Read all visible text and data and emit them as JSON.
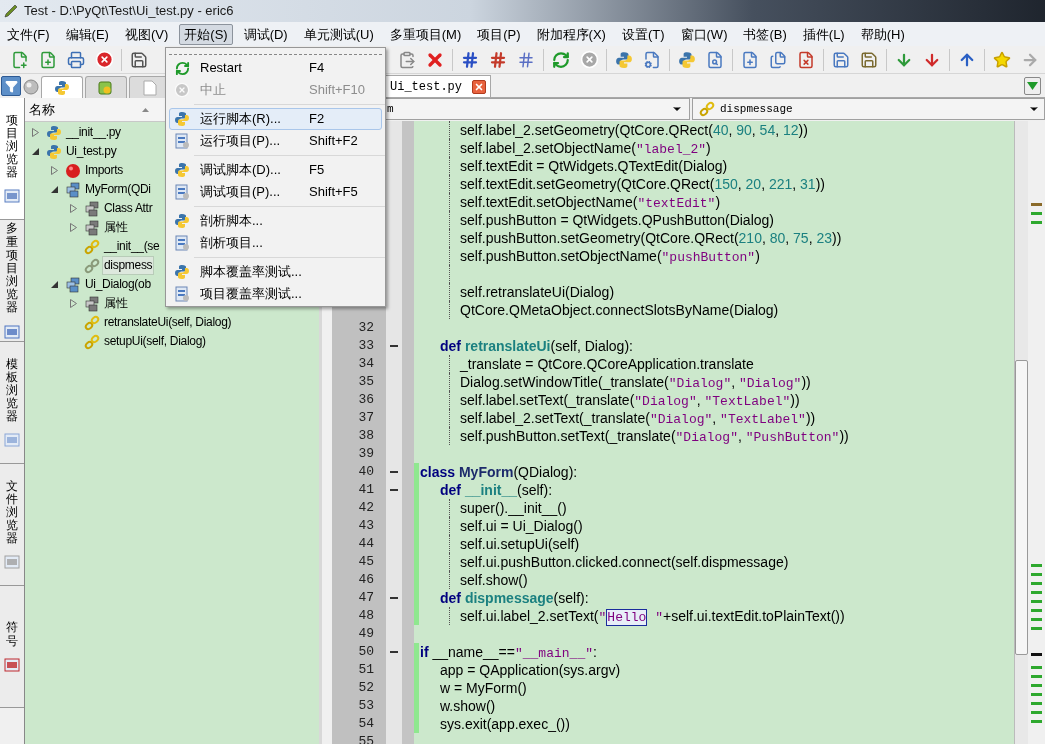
{
  "window": {
    "title": "Test - D:\\PyQt\\Test\\Ui_test.py - eric6"
  },
  "menu_bar": [
    {
      "label": "文件(F)",
      "selected": false
    },
    {
      "label": "编辑(E)",
      "selected": false
    },
    {
      "label": "视图(V)",
      "selected": false
    },
    {
      "label": "开始(S)",
      "selected": true
    },
    {
      "label": "调试(D)",
      "selected": false
    },
    {
      "label": "单元测试(U)",
      "selected": false
    },
    {
      "label": "多重项目(M)",
      "selected": false
    },
    {
      "label": "项目(P)",
      "selected": false
    },
    {
      "label": "附加程序(X)",
      "selected": false
    },
    {
      "label": "设置(T)",
      "selected": false
    },
    {
      "label": "窗口(W)",
      "selected": false
    },
    {
      "label": "书签(B)",
      "selected": false
    },
    {
      "label": "插件(L)",
      "selected": false
    },
    {
      "label": "帮助(H)",
      "selected": false
    }
  ],
  "panel_tabs": [
    {
      "kind": "python",
      "selected": true
    },
    {
      "kind": "designer",
      "selected": false
    },
    {
      "kind": "document",
      "selected": false
    }
  ],
  "side_tabs": [
    {
      "label": "项目浏览器",
      "selected": true
    },
    {
      "label": "多重项目浏览器",
      "selected": false
    },
    {
      "label": "模板浏览器",
      "selected": false
    },
    {
      "label": "文件浏览器",
      "selected": false
    },
    {
      "label": "符号",
      "selected": false
    }
  ],
  "tree": {
    "header": "名称",
    "items": [
      {
        "label": "__init__.py",
        "kind": "file",
        "expanded": false,
        "selected": false
      },
      {
        "label": "Ui_test.py",
        "kind": "file",
        "expanded": true,
        "selected": false,
        "children": [
          {
            "label": "Imports",
            "kind": "imports",
            "expanded": false,
            "selected": false
          },
          {
            "label": "MyForm(QDi",
            "kind": "class",
            "expanded": true,
            "selected": false,
            "children": [
              {
                "label": "Class Attr",
                "kind": "attributes",
                "expanded": false,
                "selected": false
              },
              {
                "label": "属性",
                "kind": "attributes",
                "expanded": false,
                "selected": false
              },
              {
                "label": "__init__(se",
                "kind": "private",
                "selected": false
              },
              {
                "label": "dispmess",
                "kind": "method",
                "selected": true
              }
            ]
          },
          {
            "label": "Ui_Dialog(ob",
            "kind": "class",
            "expanded": true,
            "selected": false,
            "children": [
              {
                "label": "属性",
                "kind": "attributes",
                "expanded": false,
                "selected": false
              },
              {
                "label": "retranslateUi(self, Dialog)",
                "kind": "method",
                "selected": false
              },
              {
                "label": "setupUi(self, Dialog)",
                "kind": "method",
                "selected": false
              }
            ]
          }
        ]
      }
    ]
  },
  "start_menu": {
    "groups": [
      {
        "items": [
          {
            "label": "Restart",
            "shortcut": "F4",
            "disabled": false,
            "selected": false
          },
          {
            "label": "中止",
            "shortcut": "Shift+F10",
            "disabled": true,
            "selected": false
          }
        ]
      },
      {
        "items": [
          {
            "label": "运行脚本(R)...",
            "shortcut": "F2",
            "disabled": false,
            "selected": true
          },
          {
            "label": "运行项目(P)...",
            "shortcut": "Shift+F2",
            "disabled": false,
            "selected": false
          }
        ]
      },
      {
        "items": [
          {
            "label": "调试脚本(D)...",
            "shortcut": "F5",
            "disabled": false,
            "selected": false
          },
          {
            "label": "调试项目(P)...",
            "shortcut": "Shift+F5",
            "disabled": false,
            "selected": false
          }
        ]
      },
      {
        "items": [
          {
            "label": "剖析脚本...",
            "disabled": false,
            "selected": false
          },
          {
            "label": "剖析项目...",
            "disabled": false,
            "selected": false
          }
        ]
      },
      {
        "items": [
          {
            "label": "脚本覆盖率测试...",
            "disabled": false,
            "selected": false
          },
          {
            "label": "项目覆盖率测试...",
            "disabled": false,
            "selected": false
          }
        ]
      }
    ]
  },
  "editor": {
    "tabs": [
      {
        "label": "Ui_test.py",
        "selected": true
      }
    ],
    "class_combo": "m",
    "method_combo": "dispmessage",
    "lines": [
      {
        "guide": true,
        "segments": [
          {
            "kind": "plain",
            "text": "\t\tself.label_2.setGeometry(QtCore.QRect("
          },
          {
            "kind": "number",
            "text": "40"
          },
          {
            "kind": "plain",
            "text": ", "
          },
          {
            "kind": "number",
            "text": "90"
          },
          {
            "kind": "plain",
            "text": ", "
          },
          {
            "kind": "number",
            "text": "54"
          },
          {
            "kind": "plain",
            "text": ", "
          },
          {
            "kind": "number",
            "text": "12"
          },
          {
            "kind": "plain",
            "text": "))"
          }
        ]
      },
      {
        "guide": true,
        "segments": [
          {
            "kind": "plain",
            "text": "\t\tself.label_2.setObjectName("
          },
          {
            "kind": "string",
            "text": "\"label_2\""
          },
          {
            "kind": "plain",
            "text": ")"
          }
        ]
      },
      {
        "guide": true,
        "segments": [
          {
            "kind": "plain",
            "text": "\t\tself.textEdit = QtWidgets.QTextEdit(Dialog)"
          }
        ]
      },
      {
        "guide": true,
        "segments": [
          {
            "kind": "plain",
            "text": "\t\tself.textEdit.setGeometry(QtCore.QRect("
          },
          {
            "kind": "number",
            "text": "150"
          },
          {
            "kind": "plain",
            "text": ", "
          },
          {
            "kind": "number",
            "text": "20"
          },
          {
            "kind": "plain",
            "text": ", "
          },
          {
            "kind": "number",
            "text": "221"
          },
          {
            "kind": "plain",
            "text": ", "
          },
          {
            "kind": "number",
            "text": "31"
          },
          {
            "kind": "plain",
            "text": "))"
          }
        ]
      },
      {
        "guide": true,
        "segments": [
          {
            "kind": "plain",
            "text": "\t\tself.textEdit.setObjectName("
          },
          {
            "kind": "string",
            "text": "\"textEdit\""
          },
          {
            "kind": "plain",
            "text": ")"
          }
        ]
      },
      {
        "guide": true,
        "segments": [
          {
            "kind": "plain",
            "text": "\t\tself.pushButton = QtWidgets.QPushButton(Dialog)"
          }
        ]
      },
      {
        "guide": true,
        "segments": [
          {
            "kind": "plain",
            "text": "\t\tself.pushButton.setGeometry(QtCore.QRect("
          },
          {
            "kind": "number",
            "text": "210"
          },
          {
            "kind": "plain",
            "text": ", "
          },
          {
            "kind": "number",
            "text": "80"
          },
          {
            "kind": "plain",
            "text": ", "
          },
          {
            "kind": "number",
            "text": "75"
          },
          {
            "kind": "plain",
            "text": ", "
          },
          {
            "kind": "number",
            "text": "23"
          },
          {
            "kind": "plain",
            "text": "))"
          }
        ]
      },
      {
        "guide": true,
        "segments": [
          {
            "kind": "plain",
            "text": "\t\tself.pushButton.setObjectName("
          },
          {
            "kind": "string",
            "text": "\"pushButton\""
          },
          {
            "kind": "plain",
            "text": ")"
          }
        ]
      },
      {
        "guide": true
      },
      {
        "guide": true,
        "segments": [
          {
            "kind": "plain",
            "text": "\t\tself.retranslateUi(Dialog)"
          }
        ]
      },
      {
        "guide": true,
        "segments": [
          {
            "kind": "plain",
            "text": "\t\tQtCore.QMetaObject.connectSlotsByName(Dialog)"
          }
        ]
      },
      {
        "number": "32"
      },
      {
        "number": "33",
        "fold": true,
        "segments": [
          {
            "kind": "keyword",
            "text": "\tdef "
          },
          {
            "kind": "name",
            "text": "retranslateUi"
          },
          {
            "kind": "plain",
            "text": "(self, Dialog):"
          }
        ]
      },
      {
        "number": "34",
        "guide": true,
        "segments": [
          {
            "kind": "plain",
            "text": "\t\t_translate = QtCore.QCoreApplication.translate"
          }
        ]
      },
      {
        "number": "35",
        "guide": true,
        "segments": [
          {
            "kind": "plain",
            "text": "\t\tDialog.setWindowTitle(_translate("
          },
          {
            "kind": "string",
            "text": "\"Dialog\""
          },
          {
            "kind": "plain",
            "text": ", "
          },
          {
            "kind": "string",
            "text": "\"Dialog\""
          },
          {
            "kind": "plain",
            "text": "))"
          }
        ]
      },
      {
        "number": "36",
        "guide": true,
        "segments": [
          {
            "kind": "plain",
            "text": "\t\tself.label.setText(_translate("
          },
          {
            "kind": "string",
            "text": "\"Dialog\""
          },
          {
            "kind": "plain",
            "text": ", "
          },
          {
            "kind": "string",
            "text": "\"TextLabel\""
          },
          {
            "kind": "plain",
            "text": "))"
          }
        ]
      },
      {
        "number": "37",
        "guide": true,
        "segments": [
          {
            "kind": "plain",
            "text": "\t\tself.label_2.setText(_translate("
          },
          {
            "kind": "string",
            "text": "\"Dialog\""
          },
          {
            "kind": "plain",
            "text": ", "
          },
          {
            "kind": "string",
            "text": "\"TextLabel\""
          },
          {
            "kind": "plain",
            "text": "))"
          }
        ]
      },
      {
        "number": "38",
        "guide": true,
        "segments": [
          {
            "kind": "plain",
            "text": "\t\tself.pushButton.setText(_translate("
          },
          {
            "kind": "string",
            "text": "\"Dialog\""
          },
          {
            "kind": "plain",
            "text": ", "
          },
          {
            "kind": "string",
            "text": "\"PushButton\""
          },
          {
            "kind": "plain",
            "text": "))"
          }
        ]
      },
      {
        "number": "39"
      },
      {
        "number": "40",
        "fold": true,
        "changed": true,
        "segments": [
          {
            "kind": "keyword",
            "text": "class "
          },
          {
            "kind": "classname",
            "text": "MyForm"
          },
          {
            "kind": "plain",
            "text": "(QDialog):"
          }
        ]
      },
      {
        "number": "41",
        "fold": true,
        "changed": true,
        "segments": [
          {
            "kind": "keyword",
            "text": "\tdef "
          },
          {
            "kind": "name",
            "text": "__init__"
          },
          {
            "kind": "plain",
            "text": "(self):"
          }
        ]
      },
      {
        "number": "42",
        "changed": true,
        "guide": true,
        "segments": [
          {
            "kind": "plain",
            "text": "\t\tsuper().__init__()"
          }
        ]
      },
      {
        "number": "43",
        "changed": true,
        "guide": true,
        "segments": [
          {
            "kind": "plain",
            "text": "\t\tself.ui = Ui_Dialog()"
          }
        ]
      },
      {
        "number": "44",
        "changed": true,
        "guide": true,
        "segments": [
          {
            "kind": "plain",
            "text": "\t\tself.ui.setupUi(self)"
          }
        ]
      },
      {
        "number": "45",
        "changed": true,
        "guide": true,
        "segments": [
          {
            "kind": "plain",
            "text": "\t\tself.ui.pushButton.clicked.connect(self.dispmessage)"
          }
        ]
      },
      {
        "number": "46",
        "changed": true,
        "guide": true,
        "segments": [
          {
            "kind": "plain",
            "text": "\t\tself.show()"
          }
        ]
      },
      {
        "number": "47",
        "fold": true,
        "changed": true,
        "segments": [
          {
            "kind": "keyword",
            "text": "\tdef "
          },
          {
            "kind": "name",
            "text": "dispmessage"
          },
          {
            "kind": "plain",
            "text": "(self):"
          }
        ]
      },
      {
        "number": "48",
        "changed": true,
        "guide": true,
        "segments": [
          {
            "kind": "plain",
            "text": "\t\tself.ui.label_2.setText("
          },
          {
            "kind": "string",
            "text": "\""
          },
          {
            "kind": "match",
            "text": "Hello"
          },
          {
            "kind": "string",
            "text": " \""
          },
          {
            "kind": "plain",
            "text": "+self.ui.textEdit.toPlainText())"
          }
        ]
      },
      {
        "number": "49"
      },
      {
        "number": "50",
        "fold": true,
        "changed": true,
        "segments": [
          {
            "kind": "keyword",
            "text": "if"
          },
          {
            "kind": "plain",
            "text": " __name__=="
          },
          {
            "kind": "string",
            "text": "\"__main__\""
          },
          {
            "kind": "plain",
            "text": ":"
          }
        ]
      },
      {
        "number": "51",
        "changed": true,
        "segments": [
          {
            "kind": "plain",
            "text": "\tapp = QApplication(sys.argv)"
          }
        ]
      },
      {
        "number": "52",
        "changed": true,
        "segments": [
          {
            "kind": "plain",
            "text": "\tw = MyForm()"
          }
        ]
      },
      {
        "number": "53",
        "changed": true,
        "segments": [
          {
            "kind": "plain",
            "text": "\tw.show()"
          }
        ]
      },
      {
        "number": "54",
        "changed": true,
        "segments": [
          {
            "kind": "plain",
            "text": "\tsys.exit(app.exec_())"
          }
        ]
      },
      {
        "number": "55"
      }
    ]
  }
}
